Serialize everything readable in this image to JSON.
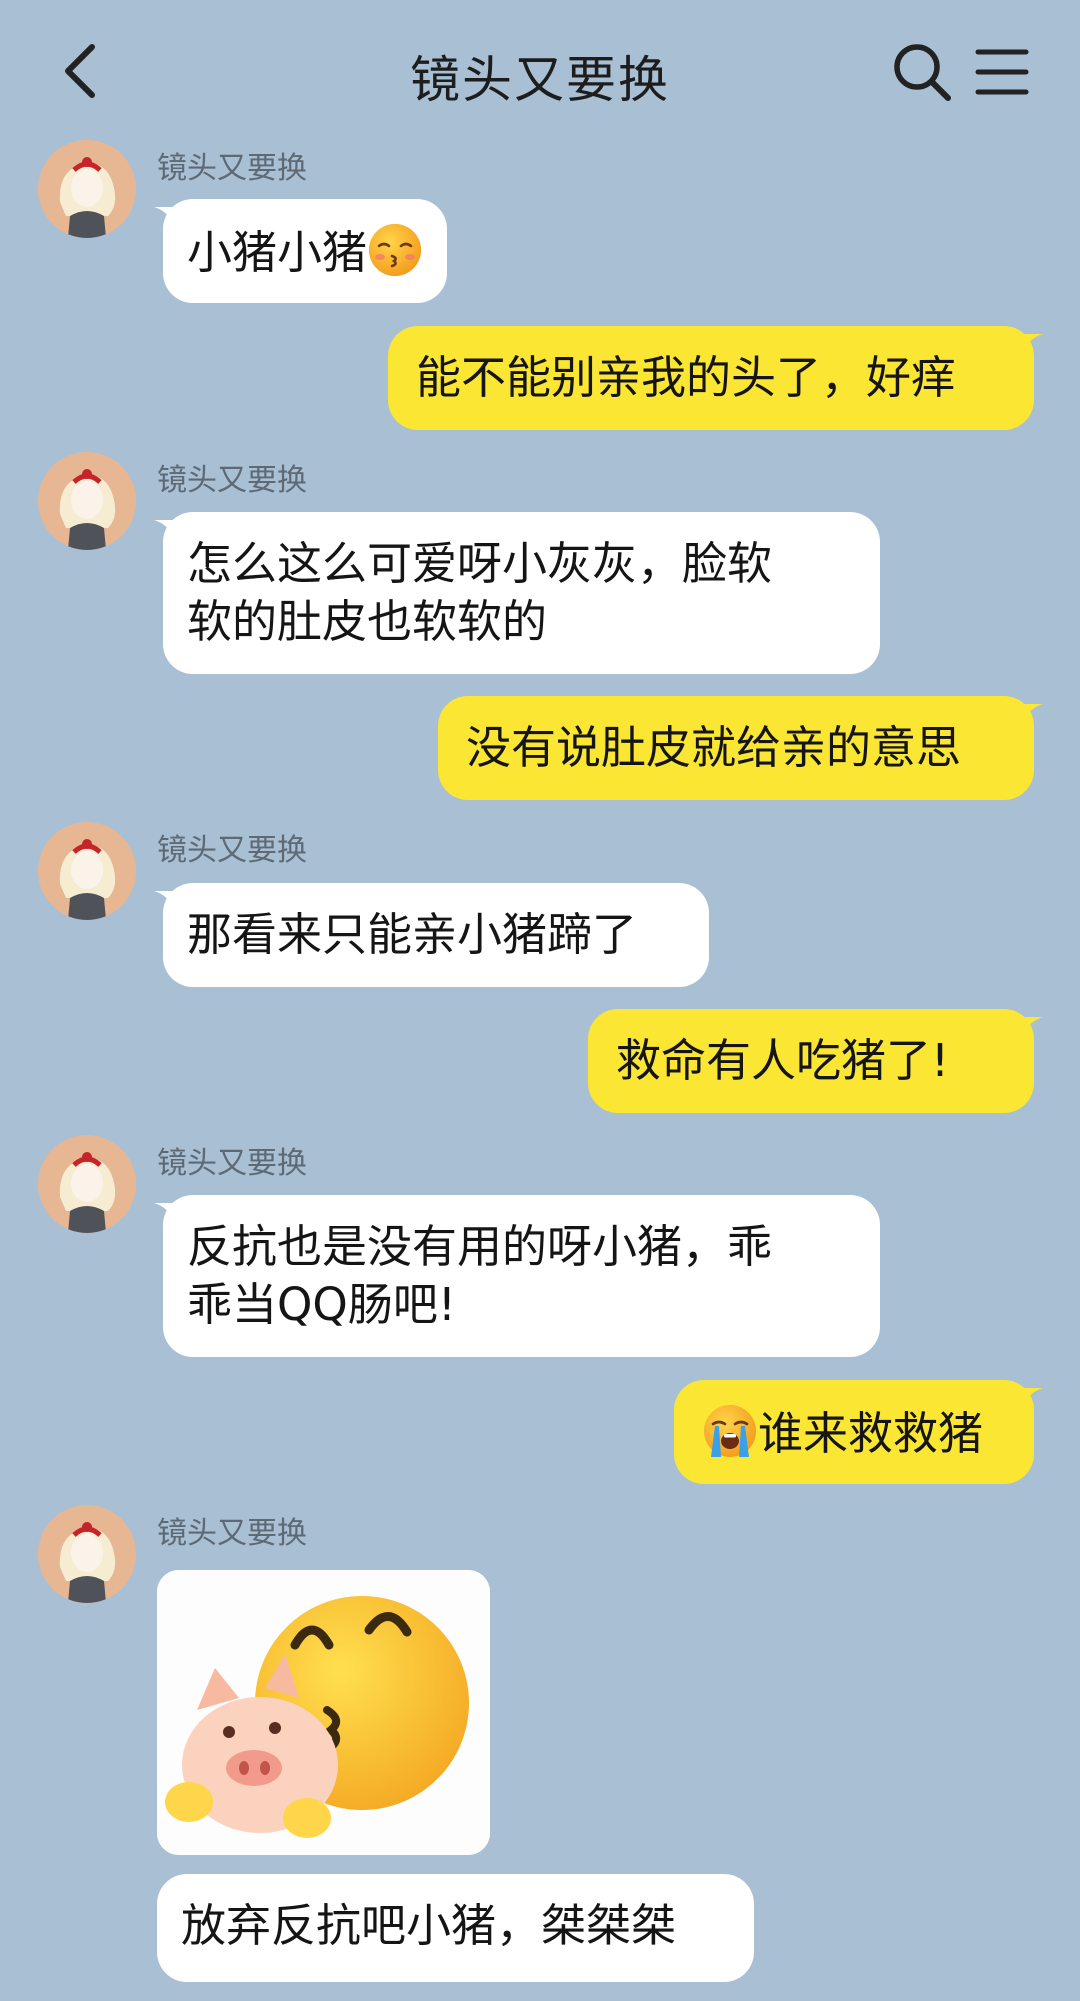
{
  "header": {
    "title": "镜头又要换",
    "back_icon": "chevron-left-icon",
    "search_icon": "search-icon",
    "menu_icon": "menu-icon"
  },
  "colors": {
    "background": "#a9bfd3",
    "incoming_bubble": "#ffffff",
    "outgoing_bubble": "#fbe634",
    "sender_name": "#5d6a76"
  },
  "messages": [
    {
      "direction": "in",
      "sender": "镜头又要换",
      "text": "小猪小猪",
      "emoji": "kissing-face-closed-eyes-icon"
    },
    {
      "direction": "out",
      "text": "能不能别亲我的头了，好痒"
    },
    {
      "direction": "in",
      "sender": "镜头又要换",
      "text_line1": "怎么这么可爱呀小灰灰，脸软",
      "text_line2": "软的肚皮也软软的"
    },
    {
      "direction": "out",
      "text": "没有说肚皮就给亲的意思"
    },
    {
      "direction": "in",
      "sender": "镜头又要换",
      "text": "那看来只能亲小猪蹄了"
    },
    {
      "direction": "out",
      "text": "救命有人吃猪了!"
    },
    {
      "direction": "in",
      "sender": "镜头又要换",
      "text_line1": "反抗也是没有用的呀小猪，乖",
      "text_line2": "乖当QQ肠吧!"
    },
    {
      "direction": "out",
      "emoji": "loudly-crying-face-icon",
      "text": "谁来救救猪"
    },
    {
      "direction": "in",
      "sender": "镜头又要换",
      "image": "pig-and-kissing-emoji-sticker"
    },
    {
      "direction": "in",
      "text": "放弃反抗吧小猪，桀桀桀"
    }
  ]
}
